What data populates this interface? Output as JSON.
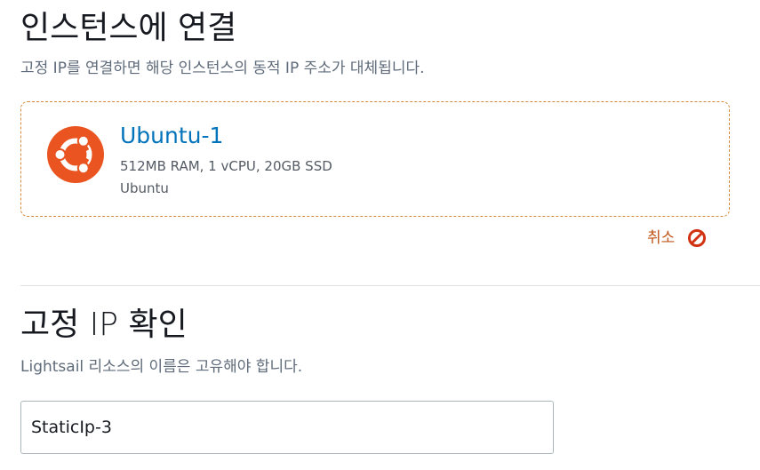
{
  "attach_section": {
    "title": "인스턴스에 연결",
    "description": "고정 IP를 연결하면 해당 인스턴스의 동적 IP 주소가 대체됩니다."
  },
  "instance": {
    "name": "Ubuntu-1",
    "specs": "512MB RAM, 1 vCPU, 20GB SSD",
    "os": "Ubuntu",
    "logo_icon": "ubuntu-logo-icon",
    "logo_color": "#e95420"
  },
  "cancel": {
    "label": "취소",
    "icon": "prohibited-icon",
    "color": "#c0561b"
  },
  "confirm_section": {
    "title": "고정 IP 확인",
    "description": "Lightsail 리소스의 이름은 고유해야 합니다."
  },
  "static_ip_name": {
    "value": "StaticIp-3"
  },
  "colors": {
    "link_blue": "#0073bb",
    "card_border": "#d48a3a",
    "secondary_text": "#5f6b7a"
  }
}
